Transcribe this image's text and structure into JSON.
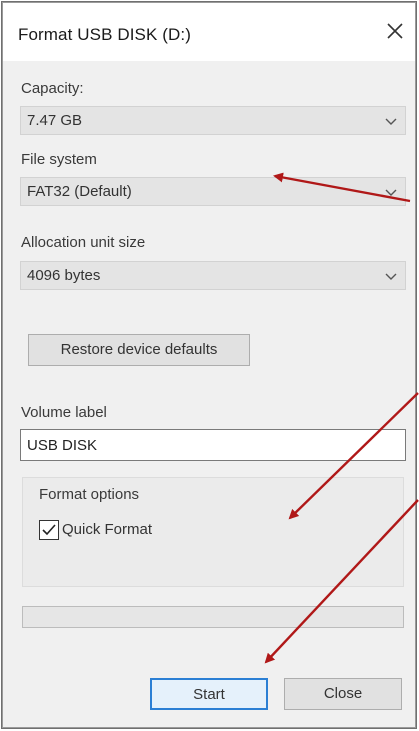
{
  "window": {
    "title": "Format USB DISK (D:)",
    "close_glyph": "✕"
  },
  "capacity": {
    "label": "Capacity:",
    "value": "7.47 GB"
  },
  "file_system": {
    "label": "File system",
    "value": "FAT32 (Default)"
  },
  "allocation": {
    "label": "Allocation unit size",
    "value": "4096 bytes"
  },
  "restore_button": {
    "label": "Restore device defaults"
  },
  "volume": {
    "label": "Volume label",
    "value": "USB DISK"
  },
  "format_options": {
    "label": "Format options",
    "quick_format": {
      "label": "Quick Format",
      "checked": true
    }
  },
  "progress": {
    "fraction": 0
  },
  "buttons": {
    "start": "Start",
    "close": "Close"
  },
  "annotation": {
    "arrow_color": "#b01818"
  },
  "icons": {
    "dropdown": "chevron-down-icon",
    "close": "close-icon",
    "check": "checkmark-icon"
  }
}
